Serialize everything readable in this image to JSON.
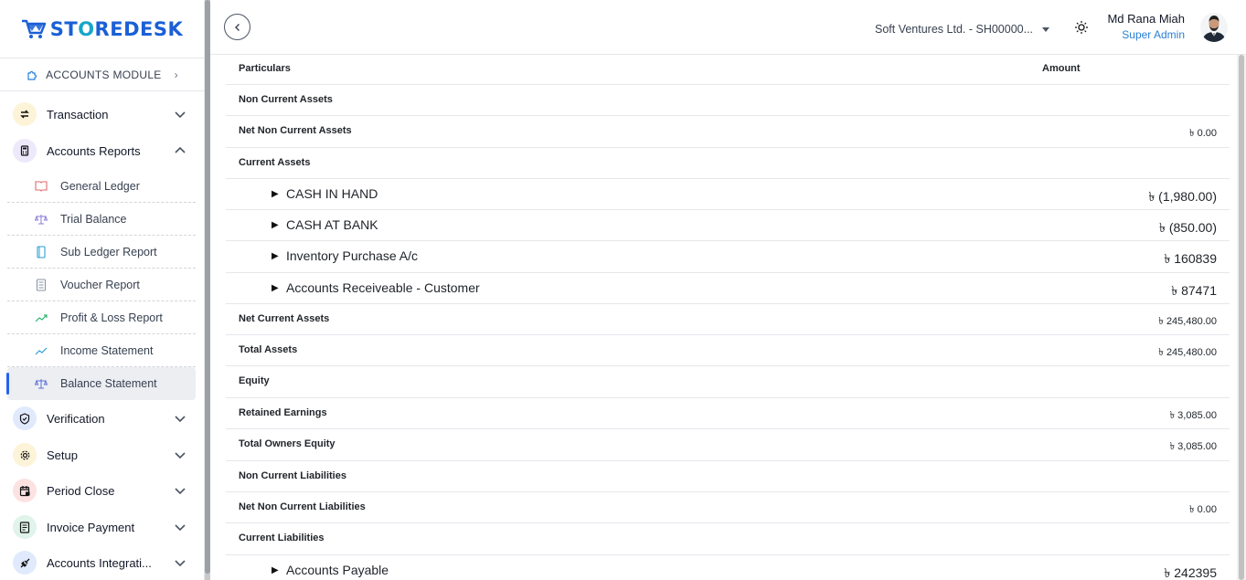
{
  "brand": {
    "name_part1": "ST",
    "name_o": "O",
    "name_part2": "REDESK"
  },
  "module": {
    "label": "ACCOUNTS MODULE"
  },
  "sidebar": {
    "groups": [
      {
        "label": "Transaction",
        "icon": "arrows-exchange-icon",
        "color": "#fdf3d8"
      },
      {
        "label": "Accounts Reports",
        "icon": "calculator-icon",
        "color": "#ede9fb"
      },
      {
        "label": "Verification",
        "icon": "shield-check-icon",
        "color": "#e0eafc"
      },
      {
        "label": "Setup",
        "icon": "gear-icon",
        "color": "#fdf3d8"
      },
      {
        "label": "Period Close",
        "icon": "calendar-lock-icon",
        "color": "#fde2e2"
      },
      {
        "label": "Invoice Payment",
        "icon": "invoice-icon",
        "color": "#e0f4ec"
      },
      {
        "label": "Accounts Integrati...",
        "icon": "plug-icon",
        "color": "#e0eafc"
      }
    ],
    "sub_items": [
      {
        "label": "General Ledger",
        "icon": "book-icon"
      },
      {
        "label": "Trial Balance",
        "icon": "scale-icon"
      },
      {
        "label": "Sub Ledger Report",
        "icon": "notebook-icon"
      },
      {
        "label": "Voucher Report",
        "icon": "document-icon"
      },
      {
        "label": "Profit & Loss Report",
        "icon": "trend-up-icon"
      },
      {
        "label": "Income Statement",
        "icon": "trend-line-icon"
      },
      {
        "label": "Balance Statement",
        "icon": "scale-icon"
      }
    ]
  },
  "header": {
    "company": "Soft Ventures Ltd. - SH00000...",
    "user_name": "Md Rana Miah",
    "user_role": "Super Admin"
  },
  "table": {
    "col_particulars": "Particulars",
    "col_amount": "Amount",
    "rows": [
      {
        "label": "Non Current Assets",
        "amount": "",
        "kind": "head"
      },
      {
        "label": "Net Non Current Assets",
        "amount": "৳ 0.00",
        "kind": "head"
      },
      {
        "label": "Current Assets",
        "amount": "",
        "kind": "head"
      },
      {
        "label": "CASH IN HAND",
        "amount": "৳ (1,980.00)",
        "kind": "detail"
      },
      {
        "label": "CASH AT BANK",
        "amount": "৳ (850.00)",
        "kind": "detail"
      },
      {
        "label": "Inventory Purchase A/c",
        "amount": "৳ 160839",
        "kind": "detail"
      },
      {
        "label": "Accounts Receiveable  - Customer",
        "amount": "৳ 87471",
        "kind": "detail"
      },
      {
        "label": "Net Current Assets",
        "amount": "৳ 245,480.00",
        "kind": "head"
      },
      {
        "label": "Total Assets",
        "amount": "৳ 245,480.00",
        "kind": "head"
      },
      {
        "label": "Equity",
        "amount": "",
        "kind": "head"
      },
      {
        "label": "Retained Earnings",
        "amount": "৳ 3,085.00",
        "kind": "head"
      },
      {
        "label": "Total Owners Equity",
        "amount": "৳ 3,085.00",
        "kind": "head"
      },
      {
        "label": "Non Current Liabilities",
        "amount": "",
        "kind": "head"
      },
      {
        "label": "Net Non Current Liabilities",
        "amount": "৳ 0.00",
        "kind": "head"
      },
      {
        "label": "Current Liabilities",
        "amount": "",
        "kind": "head"
      },
      {
        "label": "Accounts Payable",
        "amount": "৳ 242395",
        "kind": "detail"
      }
    ]
  }
}
